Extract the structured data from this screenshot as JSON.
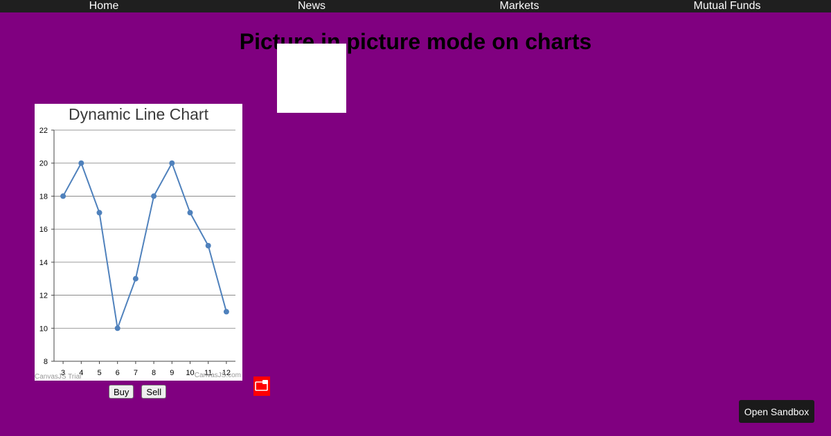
{
  "nav": {
    "items": [
      "Home",
      "News",
      "Markets",
      "Mutual Funds"
    ]
  },
  "page": {
    "title": "Picture in picture mode on charts"
  },
  "chart_data": {
    "type": "line",
    "title": "Dynamic Line Chart",
    "x": [
      3,
      4,
      5,
      6,
      7,
      8,
      9,
      10,
      11,
      12
    ],
    "series": [
      {
        "values": [
          18,
          20,
          17,
          10,
          13,
          18,
          20,
          17,
          15,
          11
        ]
      }
    ],
    "xlim": [
      2.5,
      12.5
    ],
    "ylim": [
      8,
      22
    ],
    "yticks": [
      8,
      10,
      12,
      14,
      16,
      18,
      20,
      22
    ],
    "grid": true,
    "line_color": "#4f81bc",
    "watermark_left": "CanvasJS Trial",
    "watermark_right": "CanvasJS.com"
  },
  "controls": {
    "buy_label": "Buy",
    "sell_label": "Sell",
    "pip_icon": "picture-in-picture-icon",
    "pip_color": "#ff0000"
  },
  "sandbox": {
    "label": "Open Sandbox"
  }
}
